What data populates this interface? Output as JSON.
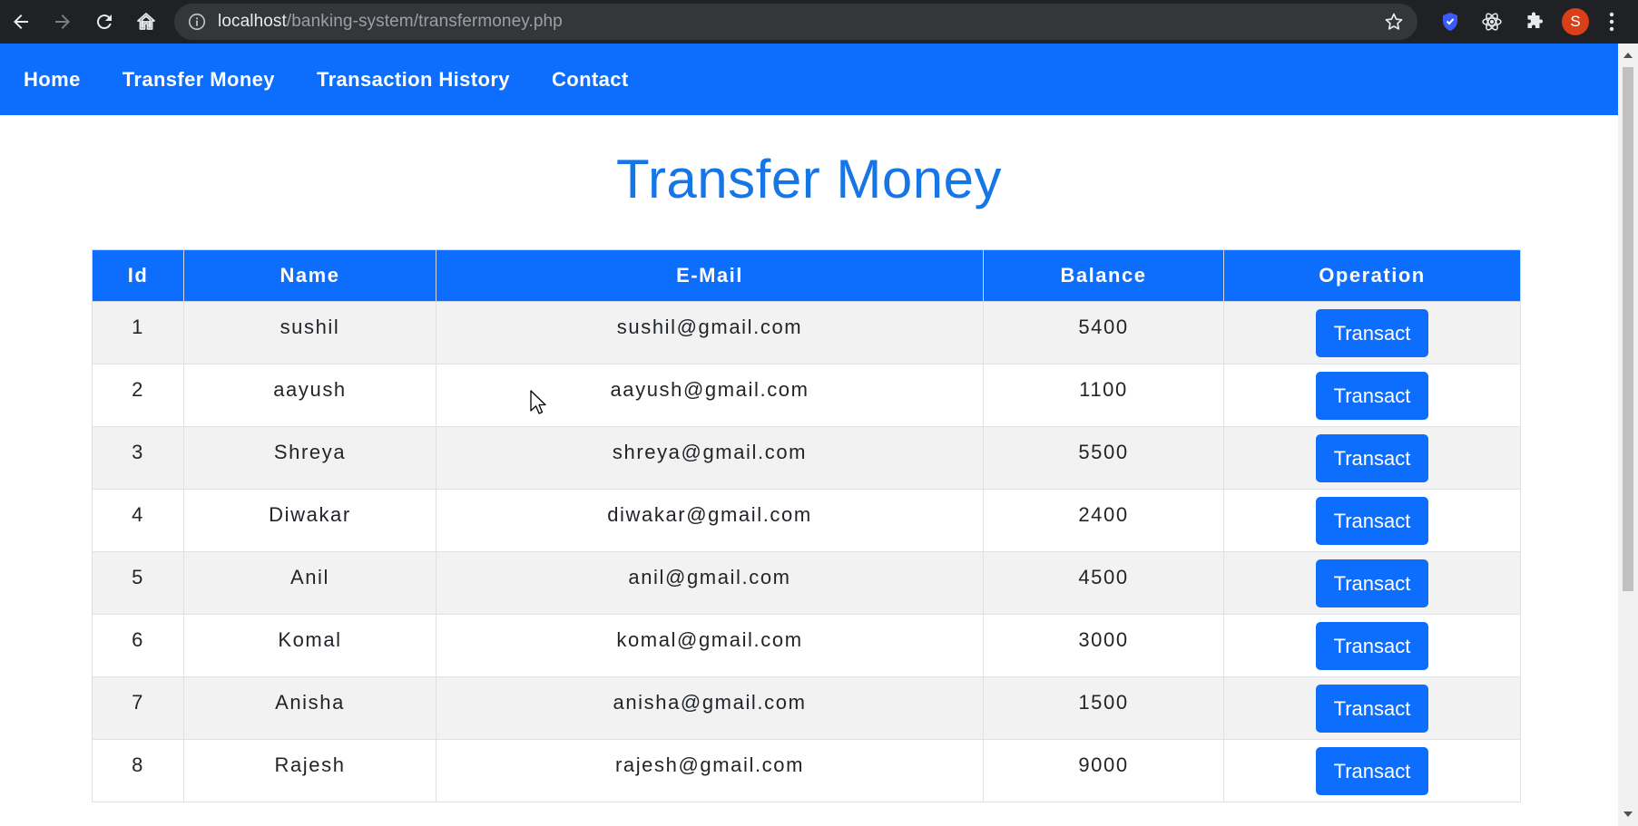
{
  "browser": {
    "url_host": "localhost",
    "url_path": "/banking-system/transfermoney.php",
    "avatar_letter": "S"
  },
  "nav": {
    "items": [
      "Home",
      "Transfer Money",
      "Transaction History",
      "Contact"
    ]
  },
  "page": {
    "title": "Transfer Money"
  },
  "table": {
    "headers": [
      "Id",
      "Name",
      "E-Mail",
      "Balance",
      "Operation"
    ],
    "button_label": "Transact",
    "rows": [
      {
        "id": "1",
        "name": "sushil",
        "email": "sushil@gmail.com",
        "balance": "5400"
      },
      {
        "id": "2",
        "name": "aayush",
        "email": "aayush@gmail.com",
        "balance": "1100"
      },
      {
        "id": "3",
        "name": "Shreya",
        "email": "shreya@gmail.com",
        "balance": "5500"
      },
      {
        "id": "4",
        "name": "Diwakar",
        "email": "diwakar@gmail.com",
        "balance": "2400"
      },
      {
        "id": "5",
        "name": "Anil",
        "email": "anil@gmail.com",
        "balance": "4500"
      },
      {
        "id": "6",
        "name": "Komal",
        "email": "komal@gmail.com",
        "balance": "3000"
      },
      {
        "id": "7",
        "name": "Anisha",
        "email": "anisha@gmail.com",
        "balance": "1500"
      },
      {
        "id": "8",
        "name": "Rajesh",
        "email": "rajesh@gmail.com",
        "balance": "9000"
      }
    ]
  },
  "colors": {
    "primary": "#0d6efd",
    "title": "#1676e6",
    "striped_row": "#f2f2f2"
  }
}
